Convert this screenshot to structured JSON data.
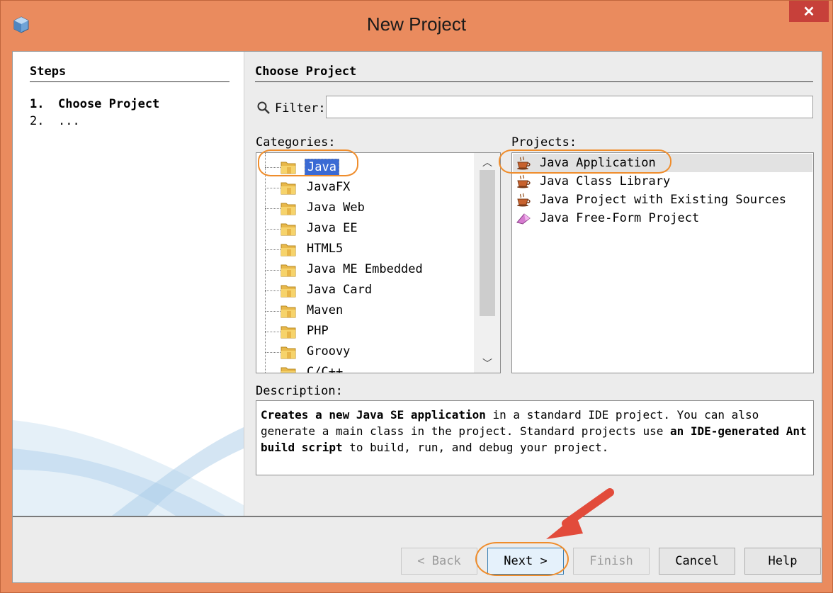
{
  "window": {
    "title": "New Project",
    "close_glyph": "✕",
    "app_icon": "netbeans-cube-icon"
  },
  "steps": {
    "title": "Steps",
    "items": [
      {
        "num": "1.",
        "label": "Choose Project"
      },
      {
        "num": "2.",
        "label": "..."
      }
    ]
  },
  "main": {
    "title": "Choose Project",
    "filter": {
      "label": "Filter:",
      "value": "",
      "placeholder": ""
    },
    "categories": {
      "label": "Categories:",
      "items": [
        "Java",
        "JavaFX",
        "Java Web",
        "Java EE",
        "HTML5",
        "Java ME Embedded",
        "Java Card",
        "Maven",
        "PHP",
        "Groovy",
        "C/C++"
      ],
      "selected": "Java"
    },
    "projects": {
      "label": "Projects:",
      "items": [
        {
          "label": "Java Application",
          "icon": "coffee-cup-icon"
        },
        {
          "label": "Java Class Library",
          "icon": "coffee-cup-icon"
        },
        {
          "label": "Java Project with Existing Sources",
          "icon": "coffee-cup-icon"
        },
        {
          "label": "Java Free-Form Project",
          "icon": "free-form-icon"
        }
      ],
      "selected": "Java Application"
    },
    "description": {
      "label": "Description:",
      "b1": "Creates a new Java SE application",
      "t1": " in a standard IDE project. You can also generate a main class in the project. Standard projects use ",
      "b2": "an IDE-generated Ant build script",
      "t2": " to build, run, and debug your project."
    }
  },
  "buttons": {
    "back": "< Back",
    "next": "Next >",
    "finish": "Finish",
    "cancel": "Cancel",
    "help": "Help"
  },
  "colors": {
    "titlebar": "#ea8b5e",
    "close": "#c7403a",
    "highlight": "#ef8d2c",
    "arrow": "#e24b3b",
    "selection": "#3a6ad4"
  }
}
